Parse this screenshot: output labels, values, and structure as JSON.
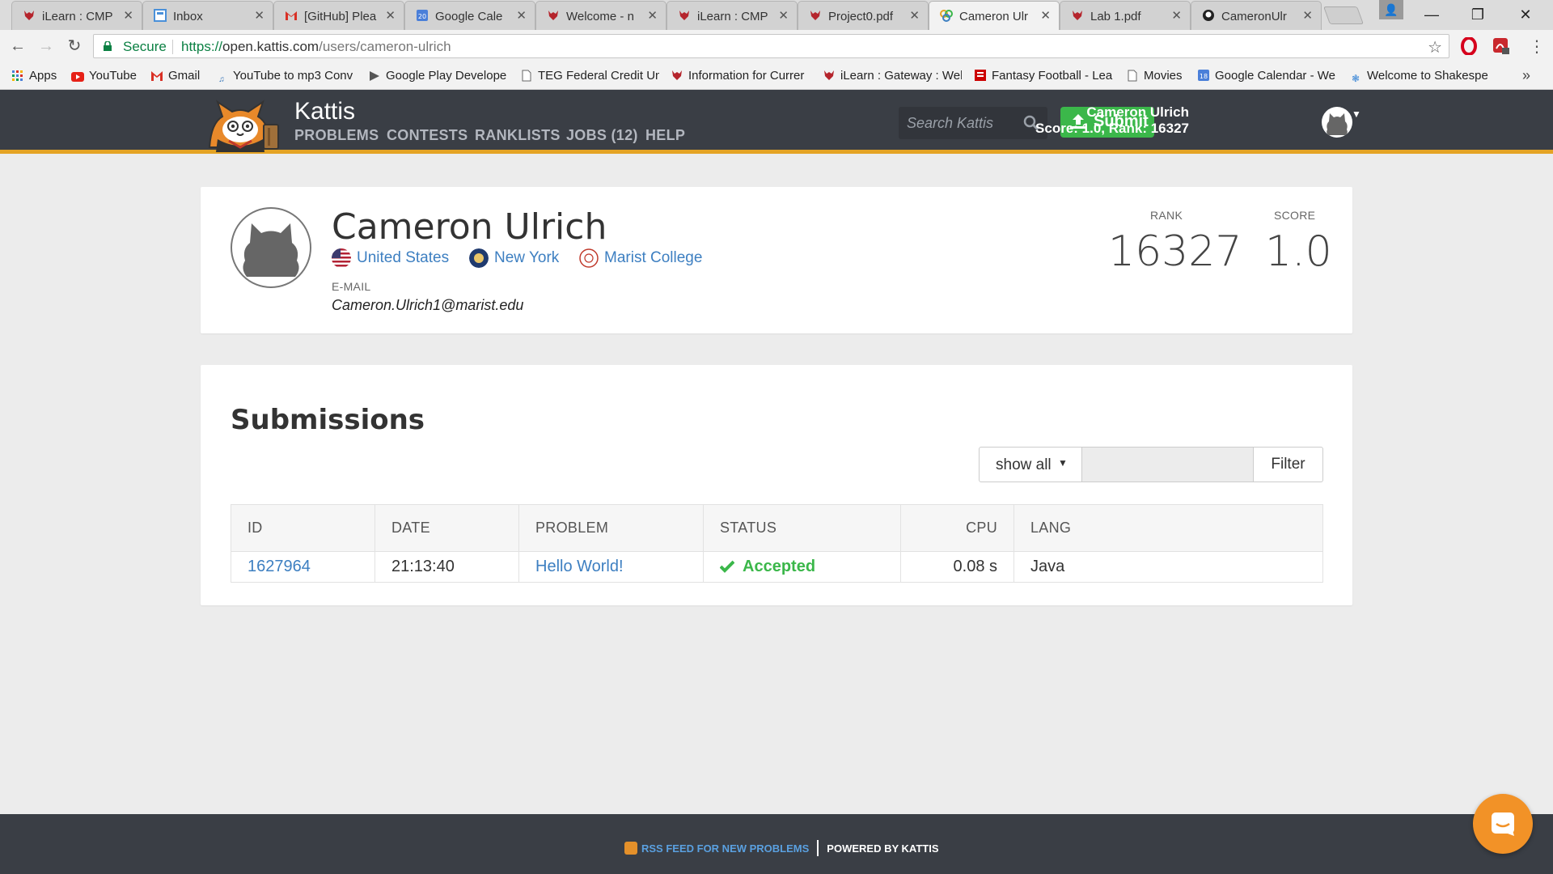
{
  "browser": {
    "tabs": [
      {
        "title": "iLearn : CMP",
        "icon": "red-fox-icon",
        "active": false
      },
      {
        "title": "Inbox",
        "icon": "inbox-icon",
        "active": false
      },
      {
        "title": "[GitHub] Plea",
        "icon": "gmail-icon",
        "active": false
      },
      {
        "title": "Google Cale",
        "icon": "google-calendar-icon",
        "active": false
      },
      {
        "title": "Welcome - n",
        "icon": "red-fox-icon",
        "active": false
      },
      {
        "title": "iLearn : CMP",
        "icon": "red-fox-icon",
        "active": false
      },
      {
        "title": "Project0.pdf",
        "icon": "red-fox-icon",
        "active": false
      },
      {
        "title": "Cameron Ulr",
        "icon": "kattis-icon",
        "active": true
      },
      {
        "title": "Lab 1.pdf",
        "icon": "red-fox-icon",
        "active": false
      },
      {
        "title": "CameronUlr",
        "icon": "github-icon",
        "active": false
      }
    ],
    "security_label": "Secure",
    "url_scheme": "https://",
    "url_host": "open.kattis.com",
    "url_path": "/users/cameron-ulrich",
    "bookmarks": [
      {
        "label": "Apps",
        "icon": "apps-grid-icon"
      },
      {
        "label": "YouTube",
        "icon": "youtube-icon"
      },
      {
        "label": "Gmail",
        "icon": "gmail-icon"
      },
      {
        "label": "YouTube to mp3 Conv",
        "icon": "mp3-icon"
      },
      {
        "label": "Google Play Develope",
        "icon": "google-play-icon"
      },
      {
        "label": "TEG Federal Credit Un",
        "icon": "page-icon"
      },
      {
        "label": "Information for Currer",
        "icon": "red-fox-icon"
      },
      {
        "label": "iLearn : Gateway : Wel",
        "icon": "red-fox-icon"
      },
      {
        "label": "Fantasy Football - Lea",
        "icon": "espn-icon"
      },
      {
        "label": "Movies",
        "icon": "page-icon"
      },
      {
        "label": "Google Calendar - We",
        "icon": "google-calendar-icon"
      },
      {
        "label": "Welcome to Shakespe",
        "icon": "shakespeare-icon"
      }
    ],
    "calendar_day": "20",
    "bookmark_calendar_day": "18"
  },
  "site": {
    "brand": "Kattis",
    "nav": [
      "PROBLEMS",
      "CONTESTS",
      "RANKLISTS",
      "JOBS (12)",
      "HELP"
    ],
    "search_placeholder": "Search Kattis",
    "submit_label": "Submit",
    "user_name": "Cameron Ulrich",
    "user_stats": "Score: 1.0, Rank: 16327",
    "colors": {
      "header": "#3a3e45",
      "accent": "#e4a324",
      "success": "#3bb74a",
      "link": "#3d7fc1"
    }
  },
  "profile": {
    "name": "Cameron Ulrich",
    "country": "United States",
    "state": "New York",
    "school": "Marist College",
    "email_label": "E-MAIL",
    "email": "Cameron.Ulrich1@marist.edu",
    "rank_label": "RANK",
    "rank": "16327",
    "score_label": "SCORE",
    "score": "1.0"
  },
  "submissions": {
    "title": "Submissions",
    "filter_option": "show all",
    "filter_button": "Filter",
    "columns": [
      "ID",
      "DATE",
      "PROBLEM",
      "STATUS",
      "CPU",
      "LANG"
    ],
    "rows": [
      {
        "id": "1627964",
        "date": "21:13:40",
        "problem": "Hello World!",
        "status": "Accepted",
        "cpu": "0.08 s",
        "lang": "Java"
      }
    ]
  },
  "footer": {
    "rss_label": "RSS FEED FOR NEW PROBLEMS",
    "powered_label": "POWERED BY KATTIS"
  }
}
